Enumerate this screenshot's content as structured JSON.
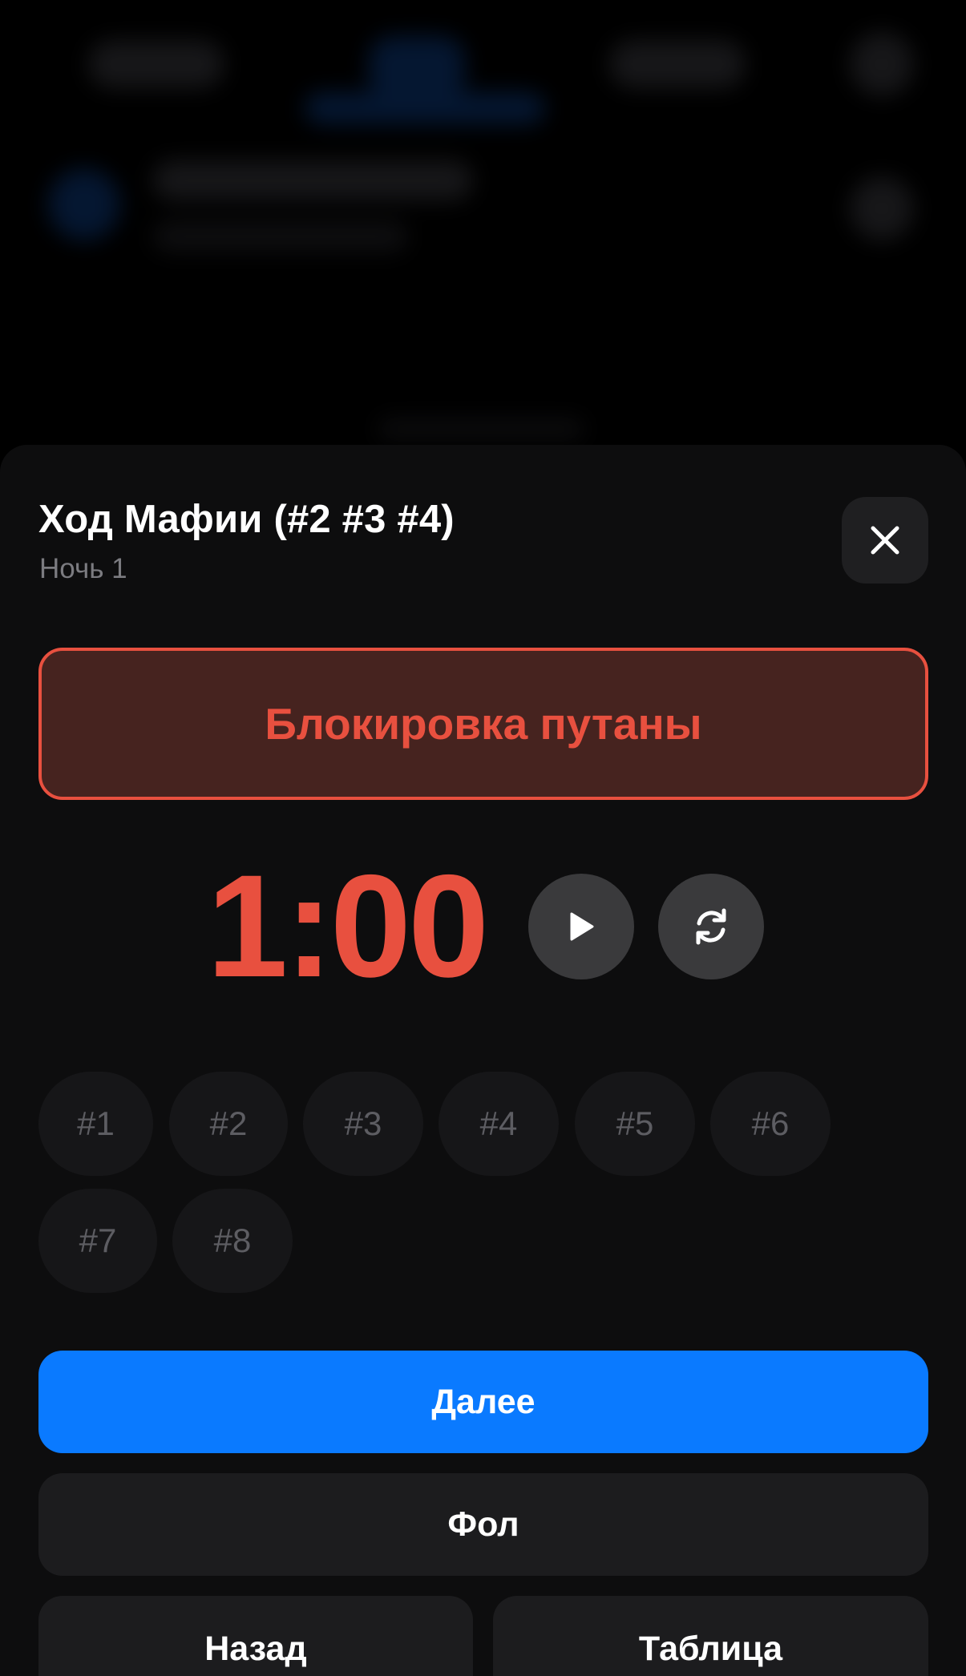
{
  "sheet": {
    "title": "Ход Мафии (#2 #3 #4)",
    "subtitle": "Ночь 1",
    "close_icon": "close-icon"
  },
  "phase": {
    "label": "Блокировка путаны",
    "accent_color": "#e8503f"
  },
  "timer": {
    "value": "1:00",
    "play_icon": "play-icon",
    "reset_icon": "refresh-icon"
  },
  "players": [
    {
      "label": "#1"
    },
    {
      "label": "#2"
    },
    {
      "label": "#3"
    },
    {
      "label": "#4"
    },
    {
      "label": "#5"
    },
    {
      "label": "#6"
    },
    {
      "label": "#7"
    },
    {
      "label": "#8"
    }
  ],
  "actions": {
    "next_label": "Далее",
    "foul_label": "Фол",
    "back_label": "Назад",
    "table_label": "Таблица",
    "primary_color": "#0a7aff"
  }
}
